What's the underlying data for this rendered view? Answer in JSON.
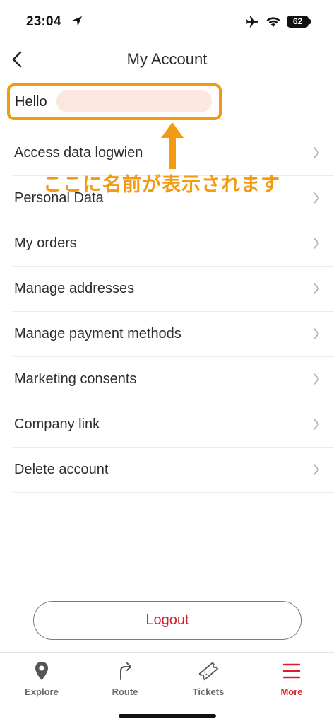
{
  "status_bar": {
    "time": "23:04",
    "battery": "62"
  },
  "nav": {
    "title": "My Account"
  },
  "greeting": {
    "text": "Hello"
  },
  "annotation": {
    "text": "ここに名前が表示されます",
    "color": "#f39a12"
  },
  "menu": {
    "items": [
      {
        "label": "Access data logwien"
      },
      {
        "label": "Personal Data"
      },
      {
        "label": "My orders"
      },
      {
        "label": "Manage addresses"
      },
      {
        "label": "Manage payment methods"
      },
      {
        "label": "Marketing consents"
      },
      {
        "label": "Company link"
      },
      {
        "label": "Delete account"
      }
    ]
  },
  "logout": {
    "label": "Logout",
    "color": "#d61f2c"
  },
  "tabs": [
    {
      "label": "Explore",
      "icon": "map-pin-icon"
    },
    {
      "label": "Route",
      "icon": "route-arrow-icon"
    },
    {
      "label": "Tickets",
      "icon": "ticket-icon"
    },
    {
      "label": "More",
      "icon": "menu-icon",
      "active": true
    }
  ]
}
